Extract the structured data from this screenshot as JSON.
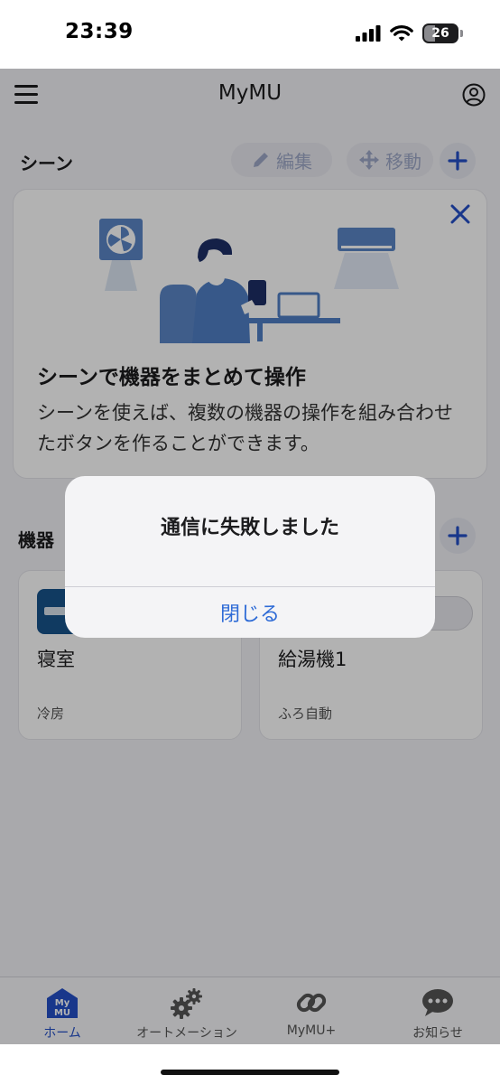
{
  "status_bar": {
    "time": "23:39",
    "battery": "26"
  },
  "header": {
    "title": "MyMU"
  },
  "scenes": {
    "title": "シーン",
    "edit_label": "編集",
    "move_label": "移動",
    "card": {
      "heading": "シーンで機器をまとめて操作",
      "body": "シーンを使えば、複数の機器の操作を組み合わせたボタンを作ることができます。"
    }
  },
  "devices": {
    "title": "機器",
    "items": [
      {
        "name": "寝室",
        "status": "冷房"
      },
      {
        "name": "給湯機1",
        "status": "ふろ自動"
      }
    ]
  },
  "tabs": [
    {
      "label": "ホーム",
      "icon_text": "My MU"
    },
    {
      "label": "オートメーション"
    },
    {
      "label": "MyMU+"
    },
    {
      "label": "お知らせ"
    }
  ],
  "alert": {
    "title": "通信に失敗しました",
    "button": "閉じる"
  },
  "colors": {
    "accent": "#2450c8",
    "alert_button": "#2e6bd6",
    "device_icon": "#17548b"
  }
}
